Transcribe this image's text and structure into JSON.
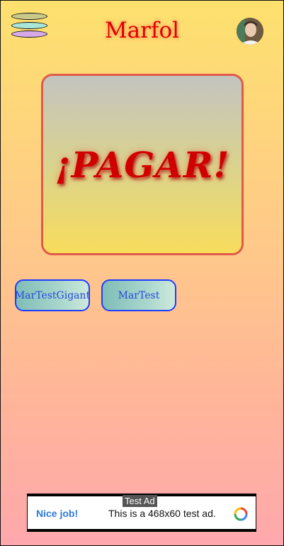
{
  "header": {
    "title": "Marfol"
  },
  "menu": {
    "icon": "stacked-layers-icon"
  },
  "pay_card": {
    "label": "¡PAGAR!"
  },
  "buttons": [
    {
      "label": "MarTestGigant"
    },
    {
      "label": "MarTest"
    }
  ],
  "ad": {
    "label": "Test Ad",
    "cta": "Nice job!",
    "text": "This is a 468x60 test ad."
  },
  "colors": {
    "title": "#e00000",
    "pay_text": "#d00000",
    "pill_border": "#1f3dff",
    "menu_layer_1": "#c9c98a",
    "menu_layer_2": "#a9e6d8",
    "menu_layer_3": "#d7a9e8"
  }
}
